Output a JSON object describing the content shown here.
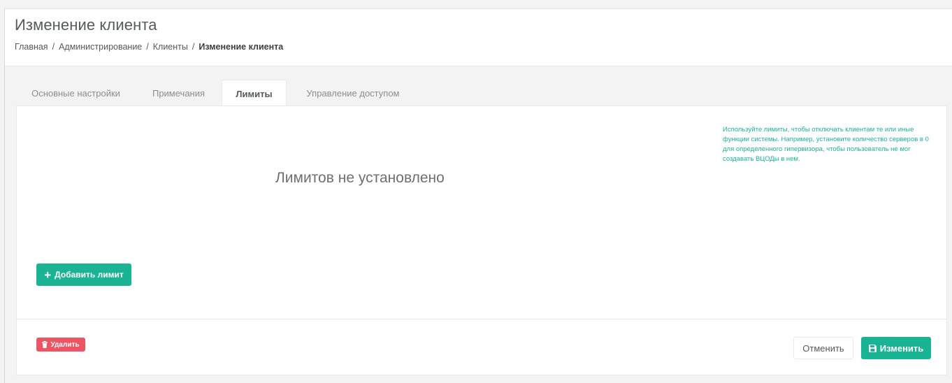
{
  "header": {
    "title": "Изменение клиента",
    "breadcrumb": [
      {
        "label": "Главная"
      },
      {
        "label": "Администрирование"
      },
      {
        "label": "Клиенты"
      },
      {
        "label": "Изменение клиента"
      }
    ],
    "breadcrumb_separator": "/"
  },
  "tabs": [
    {
      "label": "Основные настройки",
      "active": false
    },
    {
      "label": "Примечания",
      "active": false
    },
    {
      "label": "Лимиты",
      "active": true
    },
    {
      "label": "Управление доступом",
      "active": false
    }
  ],
  "limits": {
    "empty_message": "Лимитов не установлено",
    "hint": "Используйте лимиты, чтобы отключать клиентам те или иные функции системы. Например, установите количество серверов в 0 для определенного гипервизора, чтобы пользователь не мог создавать ВЦОДы в нем.",
    "add_button_label": "Добавить лимит",
    "add_button_icon": "plus-icon"
  },
  "footer": {
    "delete_label": "Удалить",
    "delete_icon": "trash-icon",
    "cancel_label": "Отменить",
    "save_label": "Изменить",
    "save_icon": "floppy-disk-icon"
  },
  "colors": {
    "accent": "#1ab394",
    "danger": "#ed5565",
    "text": "#676a6c"
  }
}
